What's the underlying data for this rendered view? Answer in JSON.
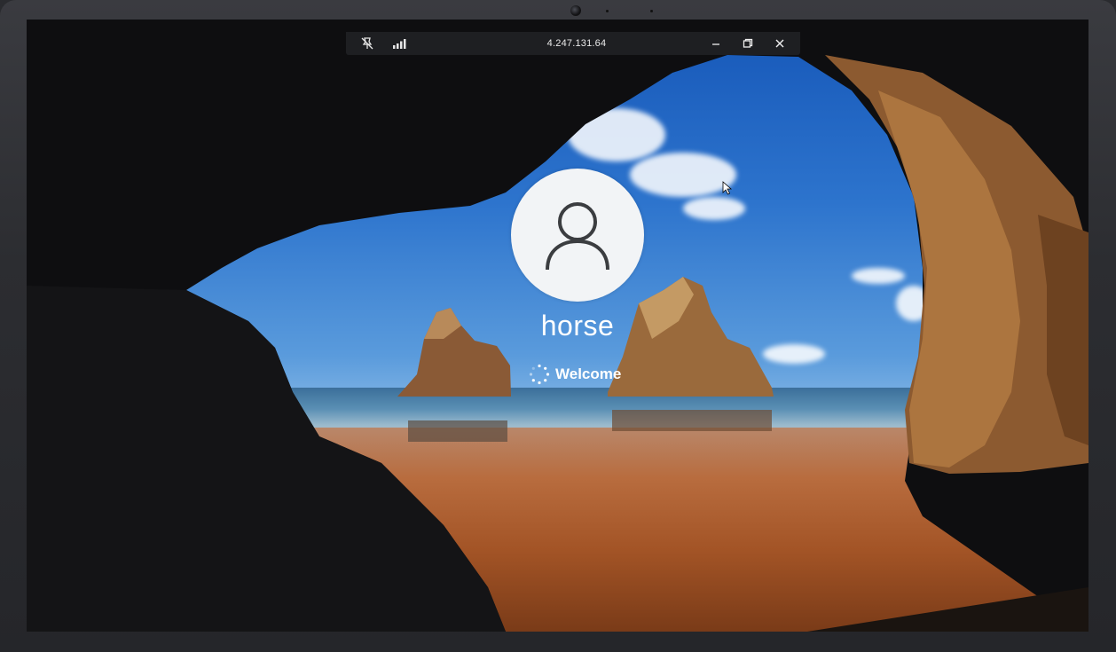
{
  "rdp_bar": {
    "title": "4.247.131.64",
    "icons": [
      "unpin-icon",
      "signal-strength-icon"
    ],
    "buttons": [
      "minimize-icon",
      "restore-icon",
      "close-icon"
    ]
  },
  "lock_screen": {
    "username": "horse",
    "status_text": "Welcome",
    "avatar_icon": "user-silhouette-icon"
  },
  "colors": {
    "sky_top": "#1657b8",
    "sand": "#b86c3e",
    "bar_bg": "#1e1f22",
    "avatar_bg": "#f2f4f6"
  }
}
